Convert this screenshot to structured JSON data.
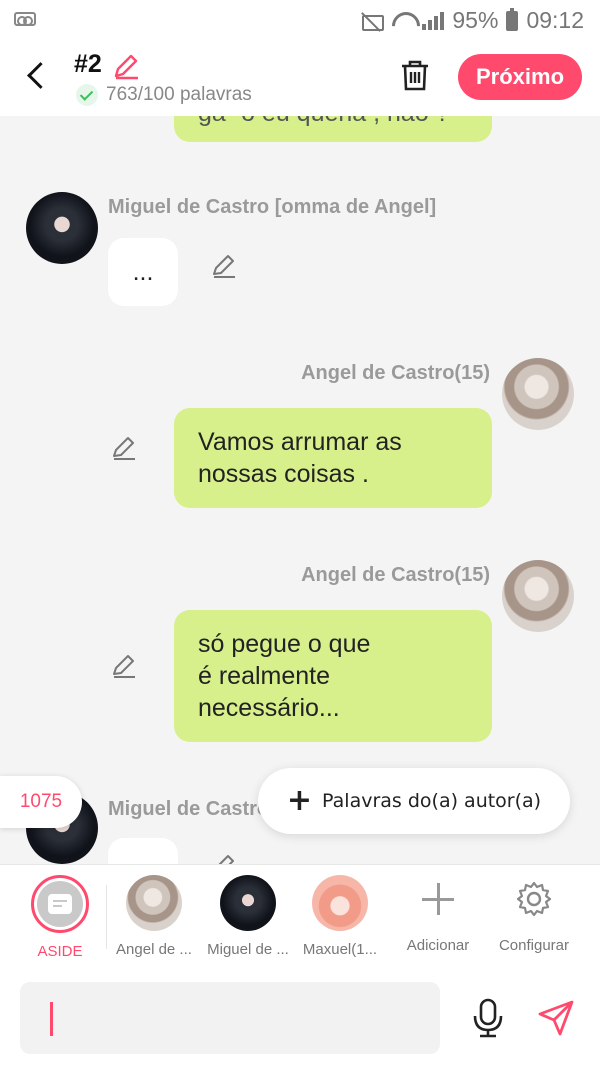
{
  "status": {
    "battery": "95%",
    "time": "09:12"
  },
  "header": {
    "title": "#2",
    "words": "763/100 palavras",
    "next_label": "Próximo"
  },
  "messages": [
    {
      "side": "right",
      "text": "ga- o eu queria , não ?"
    },
    {
      "side": "left",
      "name": "Miguel de Castro [omma de  Angel]",
      "text": "..."
    },
    {
      "side": "right",
      "name": "Angel de Castro(15)",
      "text": "Vamos arrumar as\nnossas coisas ."
    },
    {
      "side": "right",
      "name": "Angel de Castro(15)",
      "text": "só pegue o que\né realmente\nnecessário..."
    },
    {
      "side": "left",
      "name": "Miguel de Castro"
    }
  ],
  "count_badge": "1075",
  "author_words_label": "Palavras do(a) autor(a)",
  "characters": [
    {
      "label": "ASIDE"
    },
    {
      "label": "Angel de ..."
    },
    {
      "label": "Miguel de ..."
    },
    {
      "label": "Maxuel(1..."
    },
    {
      "label": "Adicionar"
    },
    {
      "label": "Configurar"
    }
  ],
  "input": {
    "value": ""
  },
  "colors": {
    "accent": "#ff4a6e",
    "bubble": "#d7f08c"
  }
}
